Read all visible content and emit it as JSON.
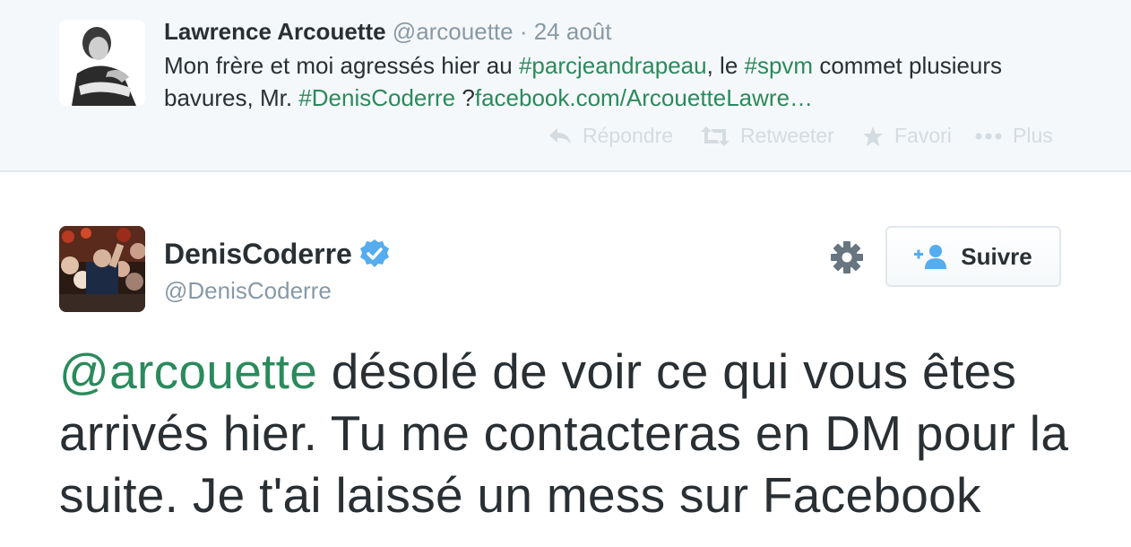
{
  "parent_tweet": {
    "author_name": "Lawrence Arcouette",
    "author_handle": "@arcouette",
    "separator": " · ",
    "date": "24 août",
    "text_parts": {
      "t1": "Mon frère et moi agressés hier au ",
      "h1": "#parcjeandrapeau",
      "t2": ", le ",
      "h2": "#spvm",
      "t3": " commet plusieurs bavures, Mr. ",
      "h3": "#DenisCoderre",
      "t4": " ?",
      "link": "facebook.com/ArcouetteLawre…"
    },
    "actions": {
      "reply": "Répondre",
      "retweet": "Retweeter",
      "favorite": "Favori",
      "more": "Plus"
    }
  },
  "main_tweet": {
    "author_name": "DenisCoderre",
    "author_handle": "@DenisCoderre",
    "verified": true,
    "follow_label": "Suivre",
    "text_parts": {
      "mention": "@arcouette",
      "body": " désolé de voir ce qui vous êtes arrivés hier. Tu me contacteras en DM pour la suite. Je t'ai laissé un mess sur Facebook"
    }
  },
  "colors": {
    "link_green": "#2a8a5c",
    "verified_blue": "#55acee",
    "follow_icon_blue": "#55acee",
    "action_gray": "#d4dbe1",
    "meta_gray": "#8899a6"
  },
  "icons": {
    "reply": "reply-arrow-icon",
    "retweet": "retweet-icon",
    "favorite": "star-icon",
    "more": "ellipsis-icon",
    "settings": "gear-icon",
    "follow": "add-user-icon",
    "verified": "verified-badge-icon"
  }
}
